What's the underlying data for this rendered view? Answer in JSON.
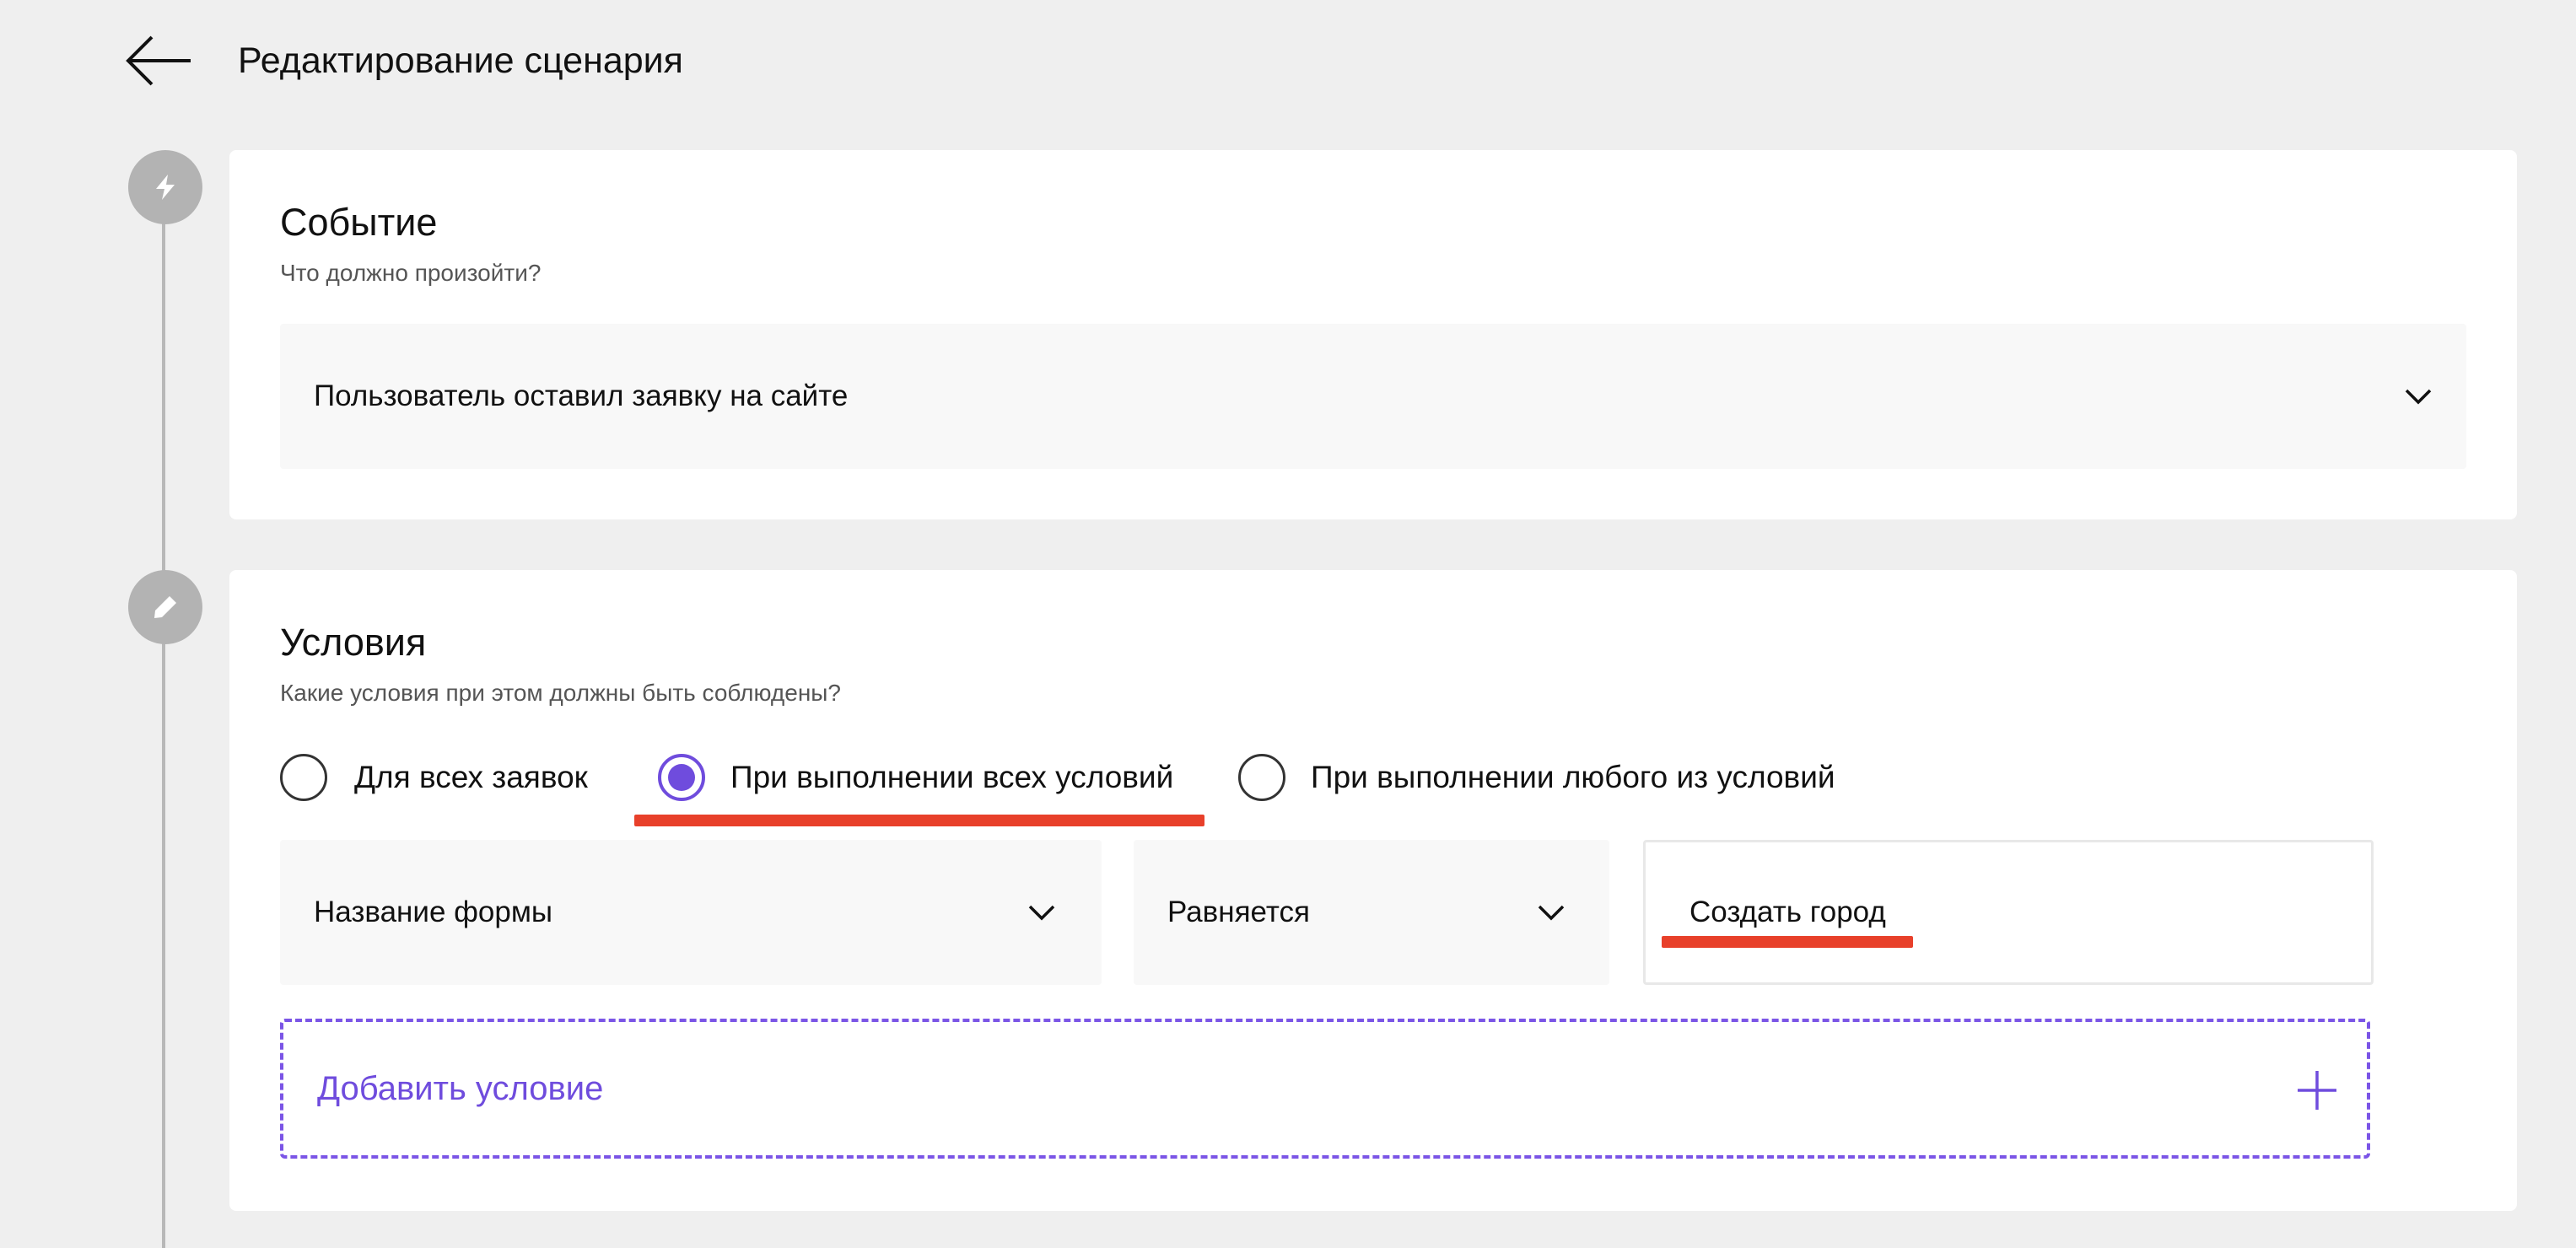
{
  "header": {
    "back_icon": "arrow-left-icon",
    "title": "Редактирование сценария"
  },
  "steps": {
    "event_icon": "lightning-icon",
    "conditions_icon": "pencil-icon"
  },
  "event": {
    "title": "Событие",
    "subtitle": "Что должно произойти?",
    "trigger_value": "Пользователь оставил заявку на сайте"
  },
  "conditions": {
    "title": "Условия",
    "subtitle": "Какие условия при этом должны быть соблюдены?",
    "mode_options": [
      {
        "label": "Для всех заявок",
        "checked": false
      },
      {
        "label": "При выполнении всех условий",
        "checked": true
      },
      {
        "label": "При выполнении любого из условий",
        "checked": false
      }
    ],
    "rule": {
      "field": "Название формы",
      "operator": "Равняется",
      "value": "Создать город"
    },
    "add_label": "Добавить условие",
    "add_icon": "plus-icon"
  },
  "colors": {
    "accent": "#6f4cdd",
    "highlight_underline": "#e8402a",
    "background": "#efefef",
    "timeline": "#b3b3b3"
  }
}
